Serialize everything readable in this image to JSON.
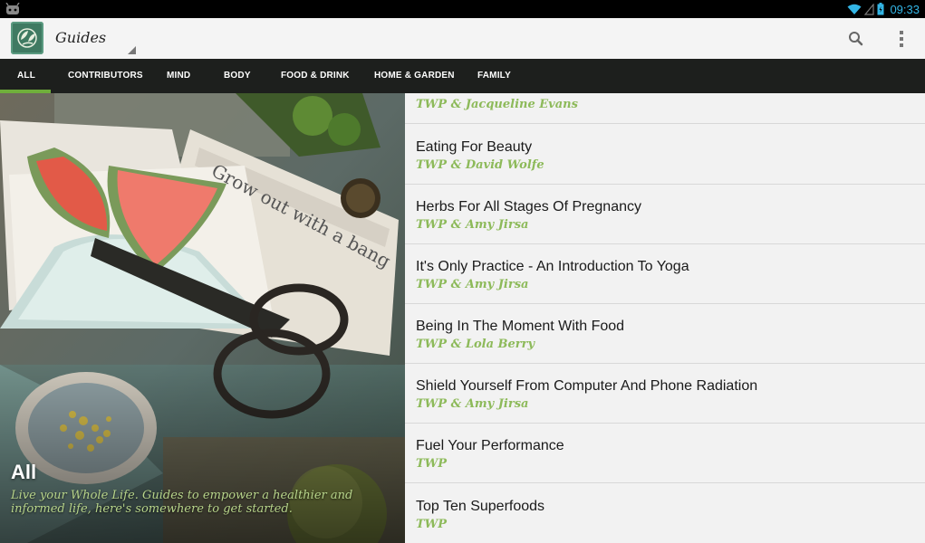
{
  "status": {
    "time": "09:33"
  },
  "actionbar": {
    "title": "Guides"
  },
  "tabs": [
    {
      "label": "ALL",
      "selected": true
    },
    {
      "label": "CONTRIBUTORS"
    },
    {
      "label": "MIND"
    },
    {
      "label": "BODY"
    },
    {
      "label": "FOOD & DRINK"
    },
    {
      "label": "HOME & GARDEN"
    },
    {
      "label": "FAMILY"
    }
  ],
  "hero": {
    "title": "All",
    "subtitle": "Live your Whole Life. Guides to empower a healthier and informed life, here's somewhere to get started.",
    "photo_text": "Grow out with a bang"
  },
  "guides": [
    {
      "title": "",
      "author": "TWP & Jacqueline Evans"
    },
    {
      "title": "Eating For Beauty",
      "author": "TWP & David Wolfe"
    },
    {
      "title": "Herbs For All Stages Of Pregnancy",
      "author": "TWP & Amy Jirsa"
    },
    {
      "title": "It's Only Practice - An Introduction To Yoga",
      "author": "TWP & Amy Jirsa"
    },
    {
      "title": "Being In The Moment With Food",
      "author": "TWP & Lola Berry"
    },
    {
      "title": "Shield Yourself From Computer And Phone Radiation",
      "author": "TWP & Amy Jirsa"
    },
    {
      "title": "Fuel Your Performance",
      "author": "TWP"
    },
    {
      "title": "Top Ten Superfoods",
      "author": "TWP"
    }
  ],
  "colors": {
    "accent": "#6fae3b",
    "author": "#8dba5a",
    "tabbar": "#1d1f1d",
    "statusbar_icons": "#33b5e5"
  }
}
